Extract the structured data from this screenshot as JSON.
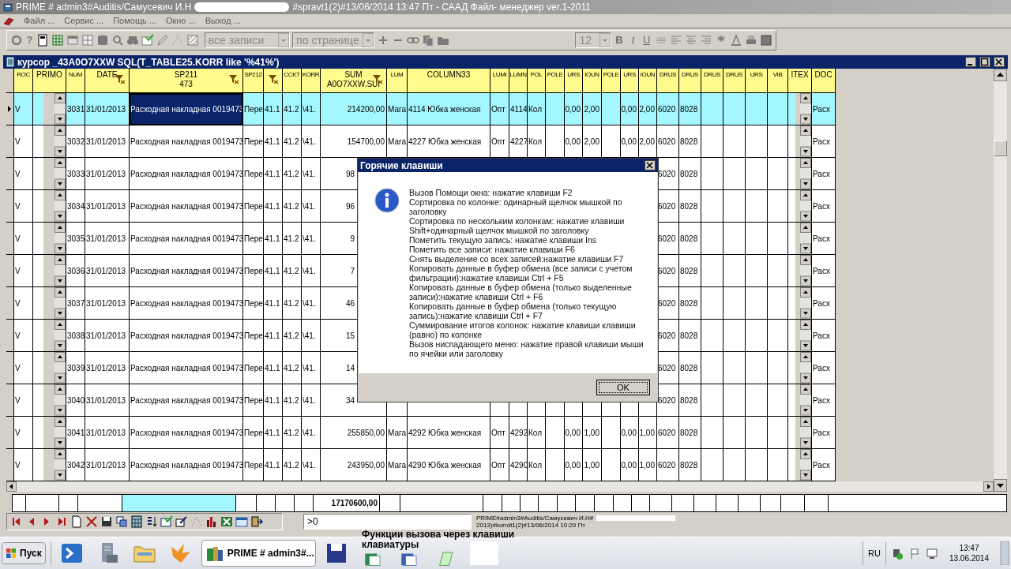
{
  "window": {
    "title_start": "PRIME # admin3#Auditis/Самусевич И.Н",
    "title_end": "#spravt1(2)#13/06/2014 13:47 Пт - СААД Файл- менеджер ver.1-2011"
  },
  "menu": [
    "Файл ...",
    "Сервис ...",
    "Помощь ...",
    "Окно ...",
    "Выход ..."
  ],
  "toolbar": {
    "help_glyph": "?",
    "records_combo": "все записи",
    "page_combo": "по странице",
    "font_size": "12",
    "format_glyphs": [
      "B",
      "I",
      "U"
    ]
  },
  "grid_window": {
    "title": "курсор _43A0O7XXW SQL(T_TABLE25.KORR like '%41%')"
  },
  "table": {
    "columns": [
      {
        "label": "ROC",
        "kind": "text",
        "sort_icon": false,
        "current": false
      },
      {
        "label": "PRIMO",
        "kind": "spinner",
        "sort_icon": false,
        "current": false
      },
      {
        "label": "NUM",
        "kind": "text",
        "sort_icon": false,
        "current": false
      },
      {
        "label": "DATE",
        "kind": "text",
        "sort_icon": true,
        "current": false
      },
      {
        "label": "SP211",
        "sublabel": "473",
        "kind": "text",
        "sort_icon": true,
        "current": true
      },
      {
        "label": "SP212",
        "kind": "text",
        "sort_icon": false,
        "current": false
      },
      {
        "kind": "text",
        "sort_icon": true,
        "current": false
      },
      {
        "label": "CCKT",
        "kind": "text",
        "sort_icon": false,
        "current": false
      },
      {
        "label": "KORR",
        "kind": "text",
        "sort_icon": false,
        "current": false
      },
      {
        "label": "SUM",
        "sublabel": "A0O7XXW.SUI",
        "kind": "number",
        "sort_icon": true,
        "current": false
      },
      {
        "label": "LUM",
        "kind": "text",
        "sort_icon": false,
        "current": false
      },
      {
        "label": "COLUMN33",
        "kind": "text",
        "sort_icon": false,
        "current": false
      },
      {
        "label": "LUMI",
        "kind": "text",
        "sort_icon": false,
        "current": false
      },
      {
        "label": "LUMN",
        "kind": "text",
        "sort_icon": false,
        "current": false
      },
      {
        "label": "POL",
        "kind": "text",
        "sort_icon": false,
        "current": false
      },
      {
        "label": "POLE",
        "kind": "text",
        "sort_icon": false,
        "current": false
      },
      {
        "label": "URS",
        "kind": "number",
        "sort_icon": false,
        "current": false
      },
      {
        "label": "IOUN",
        "kind": "number",
        "sort_icon": false,
        "current": false
      },
      {
        "label": "POLE",
        "kind": "text",
        "sort_icon": false,
        "current": false
      },
      {
        "label": "URS",
        "kind": "number",
        "sort_icon": false,
        "current": false
      },
      {
        "label": "IOUN",
        "kind": "number",
        "sort_icon": false,
        "current": false
      },
      {
        "label": "DRUS",
        "kind": "text",
        "sort_icon": false,
        "current": false
      },
      {
        "label": "DRUS",
        "kind": "text",
        "sort_icon": false,
        "current": false
      },
      {
        "label": "DRUS",
        "kind": "text",
        "sort_icon": false,
        "current": false
      },
      {
        "label": "DRUS",
        "kind": "text",
        "sort_icon": false,
        "current": false
      },
      {
        "label": "URS",
        "kind": "text",
        "sort_icon": false,
        "current": false
      },
      {
        "label": "VIB",
        "kind": "text",
        "sort_icon": false,
        "current": false
      },
      {
        "label": "ITEX",
        "kind": "spinner",
        "sort_icon": false,
        "current": false
      },
      {
        "label": "DOC",
        "kind": "text",
        "sort_icon": false,
        "current": false
      }
    ],
    "rows": [
      {
        "selected": true,
        "focused": true,
        "covered": false,
        "cells": [
          "V",
          null,
          "3031",
          "31/01/2013",
          "Расходная накладная 0019473",
          "Пере",
          "41.1",
          "41.2",
          "\\41.",
          "214200,00",
          "Мага",
          "4114 Юбка женская",
          "Опт",
          "4114",
          "Кол",
          null,
          "0,00",
          "2,00",
          null,
          "0,00",
          "2,00",
          "6020",
          "8028",
          null,
          null,
          null,
          null,
          null,
          "Расх"
        ]
      },
      {
        "selected": false,
        "focused": false,
        "covered": false,
        "cells": [
          "V",
          null,
          "3032",
          "31/01/2013",
          "Расходная накладная 0019473",
          "Пере",
          "41.1",
          "41.2",
          "\\41.",
          "154700,00",
          "Мага",
          "4227 Юбка женская",
          "Опт",
          "4227",
          "Кол",
          null,
          "0,00",
          "2,00",
          null,
          "0,00",
          "2,00",
          "6020",
          "8028",
          null,
          null,
          null,
          null,
          null,
          "Расх"
        ]
      },
      {
        "selected": false,
        "focused": false,
        "covered": true,
        "cells": [
          "V",
          null,
          "3033",
          "31/01/2013",
          "Расходная накладная 0019473",
          "Пере",
          "41.1",
          "41.2",
          "\\41.",
          "98",
          null,
          null,
          null,
          null,
          null,
          null,
          null,
          null,
          null,
          null,
          null,
          "6020",
          "8028",
          null,
          null,
          null,
          null,
          null,
          "Расх"
        ]
      },
      {
        "selected": false,
        "focused": false,
        "covered": true,
        "cells": [
          "V",
          null,
          "3034",
          "31/01/2013",
          "Расходная накладная 0019473",
          "Пере",
          "41.1",
          "41.2",
          "\\41.",
          "96",
          null,
          null,
          null,
          null,
          null,
          null,
          null,
          null,
          null,
          null,
          null,
          "6020",
          "8028",
          null,
          null,
          null,
          null,
          null,
          "Расх"
        ]
      },
      {
        "selected": false,
        "focused": false,
        "covered": true,
        "cells": [
          "V",
          null,
          "3035",
          "31/01/2013",
          "Расходная накладная 0019473",
          "Пере",
          "41.1",
          "41.2",
          "\\41.",
          "9",
          null,
          null,
          null,
          null,
          null,
          null,
          null,
          null,
          null,
          null,
          null,
          "6020",
          "8028",
          null,
          null,
          null,
          null,
          null,
          "Расх"
        ]
      },
      {
        "selected": false,
        "focused": false,
        "covered": true,
        "cells": [
          "V",
          null,
          "3036",
          "31/01/2013",
          "Расходная накладная 0019473",
          "Пере",
          "41.1",
          "41.2",
          "\\41.",
          "7",
          null,
          null,
          null,
          null,
          null,
          null,
          null,
          null,
          null,
          null,
          null,
          "6020",
          "8028",
          null,
          null,
          null,
          null,
          null,
          "Расх"
        ]
      },
      {
        "selected": false,
        "focused": false,
        "covered": true,
        "cells": [
          "V",
          null,
          "3037",
          "31/01/2013",
          "Расходная накладная 0019473",
          "Пере",
          "41.1",
          "41.2",
          "\\41.",
          "46",
          null,
          null,
          null,
          null,
          null,
          null,
          null,
          null,
          null,
          null,
          null,
          "6020",
          "8028",
          null,
          null,
          null,
          null,
          null,
          "Расх"
        ]
      },
      {
        "selected": false,
        "focused": false,
        "covered": true,
        "cells": [
          "V",
          null,
          "3038",
          "31/01/2013",
          "Расходная накладная 0019473",
          "Пере",
          "41.1",
          "41.2",
          "\\41.",
          "15",
          null,
          null,
          null,
          null,
          null,
          null,
          null,
          null,
          null,
          null,
          null,
          "6020",
          "8028",
          null,
          null,
          null,
          null,
          null,
          "Расх"
        ]
      },
      {
        "selected": false,
        "focused": false,
        "covered": true,
        "cells": [
          "V",
          null,
          "3039",
          "31/01/2013",
          "Расходная накладная 0019473",
          "Пере",
          "41.1",
          "41.2",
          "\\41.",
          "14",
          null,
          null,
          null,
          null,
          null,
          null,
          null,
          null,
          null,
          null,
          null,
          "6020",
          "8028",
          null,
          null,
          null,
          null,
          null,
          "Расх"
        ]
      },
      {
        "selected": false,
        "focused": false,
        "covered": true,
        "cells": [
          "V",
          null,
          "3040",
          "31/01/2013",
          "Расходная накладная 0019473",
          "Пере",
          "41.1",
          "41.2",
          "\\41.",
          "34",
          null,
          null,
          null,
          null,
          null,
          null,
          null,
          null,
          null,
          null,
          null,
          "6020",
          "8028",
          null,
          null,
          null,
          null,
          null,
          "Расх"
        ]
      },
      {
        "selected": false,
        "focused": false,
        "covered": false,
        "cells": [
          "V",
          null,
          "3041",
          "31/01/2013",
          "Расходная накладная 0019473",
          "Пере",
          "41.1",
          "41.2",
          "\\41.",
          "255850,00",
          "Мага",
          "4292 Юбка женская",
          "Опт",
          "4292",
          "Кол",
          null,
          "0,00",
          "1,00",
          null,
          "0,00",
          "1,00",
          "6020",
          "8028",
          null,
          null,
          null,
          null,
          null,
          "Расх"
        ]
      },
      {
        "selected": false,
        "focused": false,
        "covered": false,
        "cells": [
          "V",
          null,
          "3042",
          "31/01/2013",
          "Расходная накладная 0019473",
          "Пере",
          "41.1",
          "41.2",
          "\\41.",
          "243950,00",
          "Мага",
          "4290 Юбка женская",
          "Опт",
          "4290",
          "Кол",
          null,
          "0,00",
          "1,00",
          null,
          "0,00",
          "1,00",
          "6020",
          "8028",
          null,
          null,
          null,
          null,
          null,
          "Расх"
        ]
      }
    ],
    "total": "17170600,00"
  },
  "dialog": {
    "title": "Горячие клавиши",
    "lines": [
      "Вызов Помощи окна: нажатие клавиши F2",
      "Сортировка по колонке: одинарный щелчок мышкой по заголовку",
      "Сортировка по нескольким колонкам: нажатие клавиши Shift+одинарный щелчок мышкой по заголовку",
      "Пометить текущую запись: нажатие клавиши Ins",
      "Пометить все записи: нажатие клавиши F6",
      "Снять выделение со всех записей:нажатие клавиши F7",
      "Копировать данные в буфер обмена (все записи с учетом фильтрации):нажатие клавиши Ctrl + F5",
      "Копировать данные в буфер обмена (только выделенные записи):нажатие клавиши Ctrl + F6",
      "Копировать данные в буфер обмена (только текущую запись):нажатие клавиши Ctrl + F7",
      "Суммирование итогов колонок: нажатие клавиши клавиши (равно) по колонке",
      "Вызов ниспадающего меню: нажатие правой клавиши мыши по ячейки или заголовку"
    ],
    "ok": "OK"
  },
  "filter": {
    "value": ">0"
  },
  "status_text": [
    "PRIME#admin3#Auditis/Самусевич И.Н#",
    "2013)#korrdt1(2)#13/06/2014 10:29 Пт"
  ],
  "taskbar": {
    "start": "Пуск",
    "active_task": "PRIME # admin3#...",
    "tooltip": "Функции вызова через клавиши клавиатуры",
    "language": "RU",
    "time": "13:47",
    "date": "13.06.2014"
  }
}
